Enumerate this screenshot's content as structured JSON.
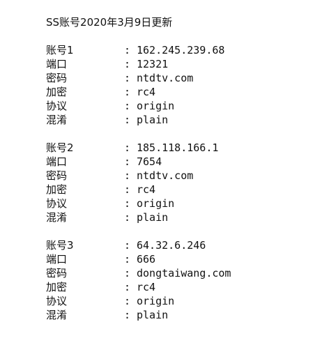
{
  "title": "SS账号2020年3月9日更新",
  "separator": ":",
  "accounts": [
    {
      "fields": [
        {
          "label": "账号1",
          "value": "162.245.239.68"
        },
        {
          "label": "端口",
          "value": "12321"
        },
        {
          "label": "密码",
          "value": "ntdtv.com"
        },
        {
          "label": "加密",
          "value": "rc4"
        },
        {
          "label": "协议",
          "value": "origin"
        },
        {
          "label": "混淆",
          "value": "plain"
        }
      ]
    },
    {
      "fields": [
        {
          "label": "账号2",
          "value": "185.118.166.1"
        },
        {
          "label": "端口",
          "value": "7654"
        },
        {
          "label": "密码",
          "value": "ntdtv.com"
        },
        {
          "label": "加密",
          "value": "rc4"
        },
        {
          "label": "协议",
          "value": "origin"
        },
        {
          "label": "混淆",
          "value": "plain"
        }
      ]
    },
    {
      "fields": [
        {
          "label": "账号3",
          "value": "64.32.6.246"
        },
        {
          "label": "端口",
          "value": "666"
        },
        {
          "label": "密码",
          "value": "dongtaiwang.com"
        },
        {
          "label": "加密",
          "value": "rc4"
        },
        {
          "label": "协议",
          "value": "origin"
        },
        {
          "label": "混淆",
          "value": "plain"
        }
      ]
    }
  ]
}
